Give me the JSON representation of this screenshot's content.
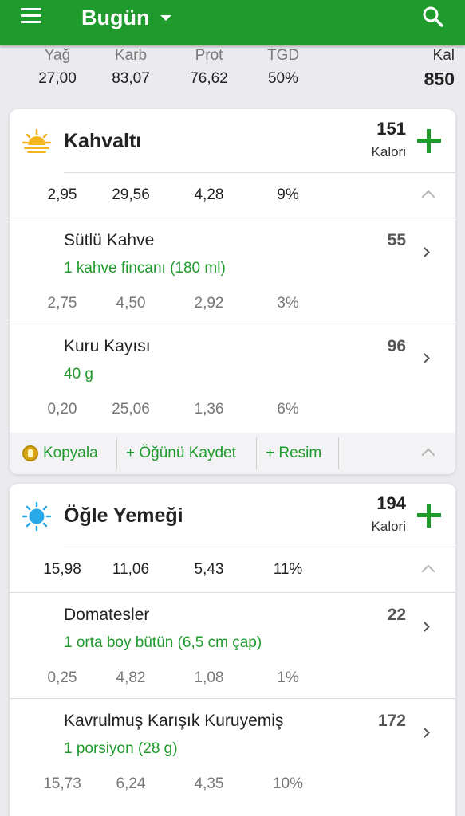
{
  "appbar": {
    "title": "Bugün",
    "bg": "#1f9a2c"
  },
  "summary": {
    "fat": {
      "label": "Yağ",
      "value": "27,00"
    },
    "carb": {
      "label": "Karb",
      "value": "83,07"
    },
    "prot": {
      "label": "Prot",
      "value": "76,62"
    },
    "rdi": {
      "label": "TGD",
      "value": "50%"
    },
    "cal": {
      "label": "Kal",
      "value": "850"
    }
  },
  "meals": [
    {
      "name": "Kahvaltı",
      "icon": "sunrise-icon",
      "calories": "151",
      "calories_label": "Kalori",
      "macros": [
        "2,95",
        "29,56",
        "4,28",
        "9%"
      ],
      "foods": [
        {
          "name": "Sütlü Kahve",
          "serving": "1 kahve fincanı (180 ml)",
          "calories": "55",
          "macros": [
            "2,75",
            "4,50",
            "2,92",
            "3%"
          ]
        },
        {
          "name": "Kuru Kayısı",
          "serving": "40 g",
          "calories": "96",
          "macros": [
            "0,20",
            "25,06",
            "1,36",
            "6%"
          ]
        }
      ],
      "actions": {
        "copy": "Kopyala",
        "save_meal": "+ Öğünü Kaydet",
        "photo": "+ Resim"
      }
    },
    {
      "name": "Öğle Yemeği",
      "icon": "sun-icon",
      "calories": "194",
      "calories_label": "Kalori",
      "macros": [
        "15,98",
        "11,06",
        "5,43",
        "11%"
      ],
      "foods": [
        {
          "name": "Domatesler",
          "serving": "1 orta boy bütün (6,5 cm çap)",
          "calories": "22",
          "macros": [
            "0,25",
            "4,82",
            "1,08",
            "1%"
          ]
        },
        {
          "name": "Kavrulmuş Karışık Kuruyemiş",
          "serving": "1 porsiyon (28 g)",
          "calories": "172",
          "macros": [
            "15,73",
            "6,24",
            "4,35",
            "10%"
          ]
        }
      ]
    }
  ]
}
